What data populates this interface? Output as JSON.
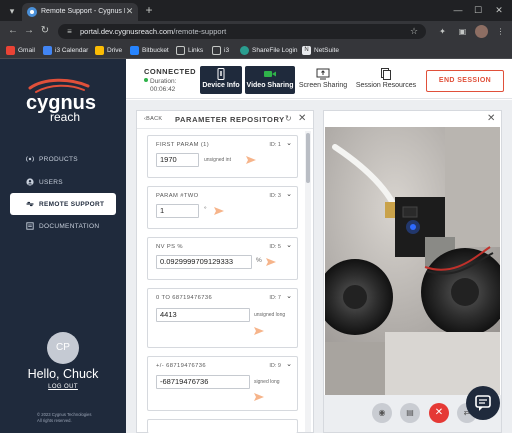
{
  "browser": {
    "tab_title": "Remote Support - Cygnus Reach",
    "url_host": "portal.dev.cygnusreach.com",
    "url_path": "/remote-support",
    "bookmarks": [
      "Gmail",
      "i3 Calendar",
      "Drive",
      "Bitbucket",
      "Links",
      "i3",
      "ShareFile Login",
      "NetSuite"
    ]
  },
  "brand": {
    "line1": "cygnus",
    "line2": "reach"
  },
  "sidebar": {
    "items": [
      {
        "label": "PRODUCTS",
        "icon": "signal-icon"
      },
      {
        "label": "USERS",
        "icon": "user-icon"
      },
      {
        "label": "REMOTE SUPPORT",
        "icon": "link-icon",
        "active": true
      },
      {
        "label": "DOCUMENTATION",
        "icon": "document-icon"
      }
    ],
    "avatar_initials": "CP",
    "greeting": "Hello, Chuck",
    "logout": "LOG OUT",
    "copyright_line1": "© 2023 Cygnus Technologies",
    "copyright_line2": "All rights reserved."
  },
  "session": {
    "status": "CONNECTED",
    "duration_label": "Duration:",
    "duration_value": "00:06:42",
    "controls": [
      {
        "label": "Device Info",
        "active": true
      },
      {
        "label": "Video Sharing",
        "active": true
      },
      {
        "label": "Screen Sharing",
        "active": false
      },
      {
        "label": "Session Resources",
        "active": false
      }
    ],
    "end_label": "END SESSION"
  },
  "param_panel": {
    "back": "BACK",
    "title": "PARAMETER REPOSITORY",
    "params": [
      {
        "name": "FIRST PARAM (1)",
        "id": "ID: 1",
        "value": "1970",
        "unit": "unsigned int"
      },
      {
        "name": "PARAM #TWO",
        "id": "ID: 3",
        "value": "1",
        "unit": "°"
      },
      {
        "name": "NV PS %",
        "id": "ID: 5",
        "value": "0.0929999709129333",
        "unit": "%"
      },
      {
        "name": "0 TO 68719476736",
        "id": "ID: 7",
        "value": "4413",
        "unit": "unsigned long"
      },
      {
        "name": "+/- 68719476736",
        "id": "ID: 9",
        "value": "-68719476736",
        "unit": "signed long"
      }
    ]
  },
  "colors": {
    "sidebar_bg": "#1f2a3c",
    "accent_red": "#e0503a",
    "send_orange": "#f6b48a",
    "connected_green": "#2fb34a"
  }
}
